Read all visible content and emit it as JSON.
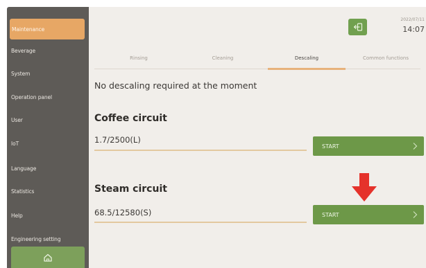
{
  "sidebar": {
    "items": [
      {
        "label": "Maintenance",
        "active": true
      },
      {
        "label": "Beverage"
      },
      {
        "label": "System"
      },
      {
        "label": "Operation panel"
      },
      {
        "label": "User"
      },
      {
        "label": "IoT"
      },
      {
        "label": "Language"
      },
      {
        "label": "Statistics"
      },
      {
        "label": "Help"
      },
      {
        "label": "Engineering setting"
      }
    ],
    "home_icon": "home-icon"
  },
  "header": {
    "exit_icon": "exit-icon",
    "date": "2022/07/11",
    "time": "14:07"
  },
  "tabs": [
    {
      "label": "Rinsing"
    },
    {
      "label": "Cleaning"
    },
    {
      "label": "Descaling",
      "active": true
    },
    {
      "label": "Common functions"
    }
  ],
  "main": {
    "status_message": "No descaling required at the moment",
    "sections": [
      {
        "title": "Coffee circuit",
        "counter": "1.7/2500(L)",
        "button_label": "START"
      },
      {
        "title": "Steam circuit",
        "counter": "68.5/12580(S)",
        "button_label": "START"
      }
    ]
  },
  "colors": {
    "sidebar_bg": "#5e5b57",
    "active_item": "#e7a765",
    "button_green": "#6d9848",
    "annotation_red": "#e5322b"
  }
}
